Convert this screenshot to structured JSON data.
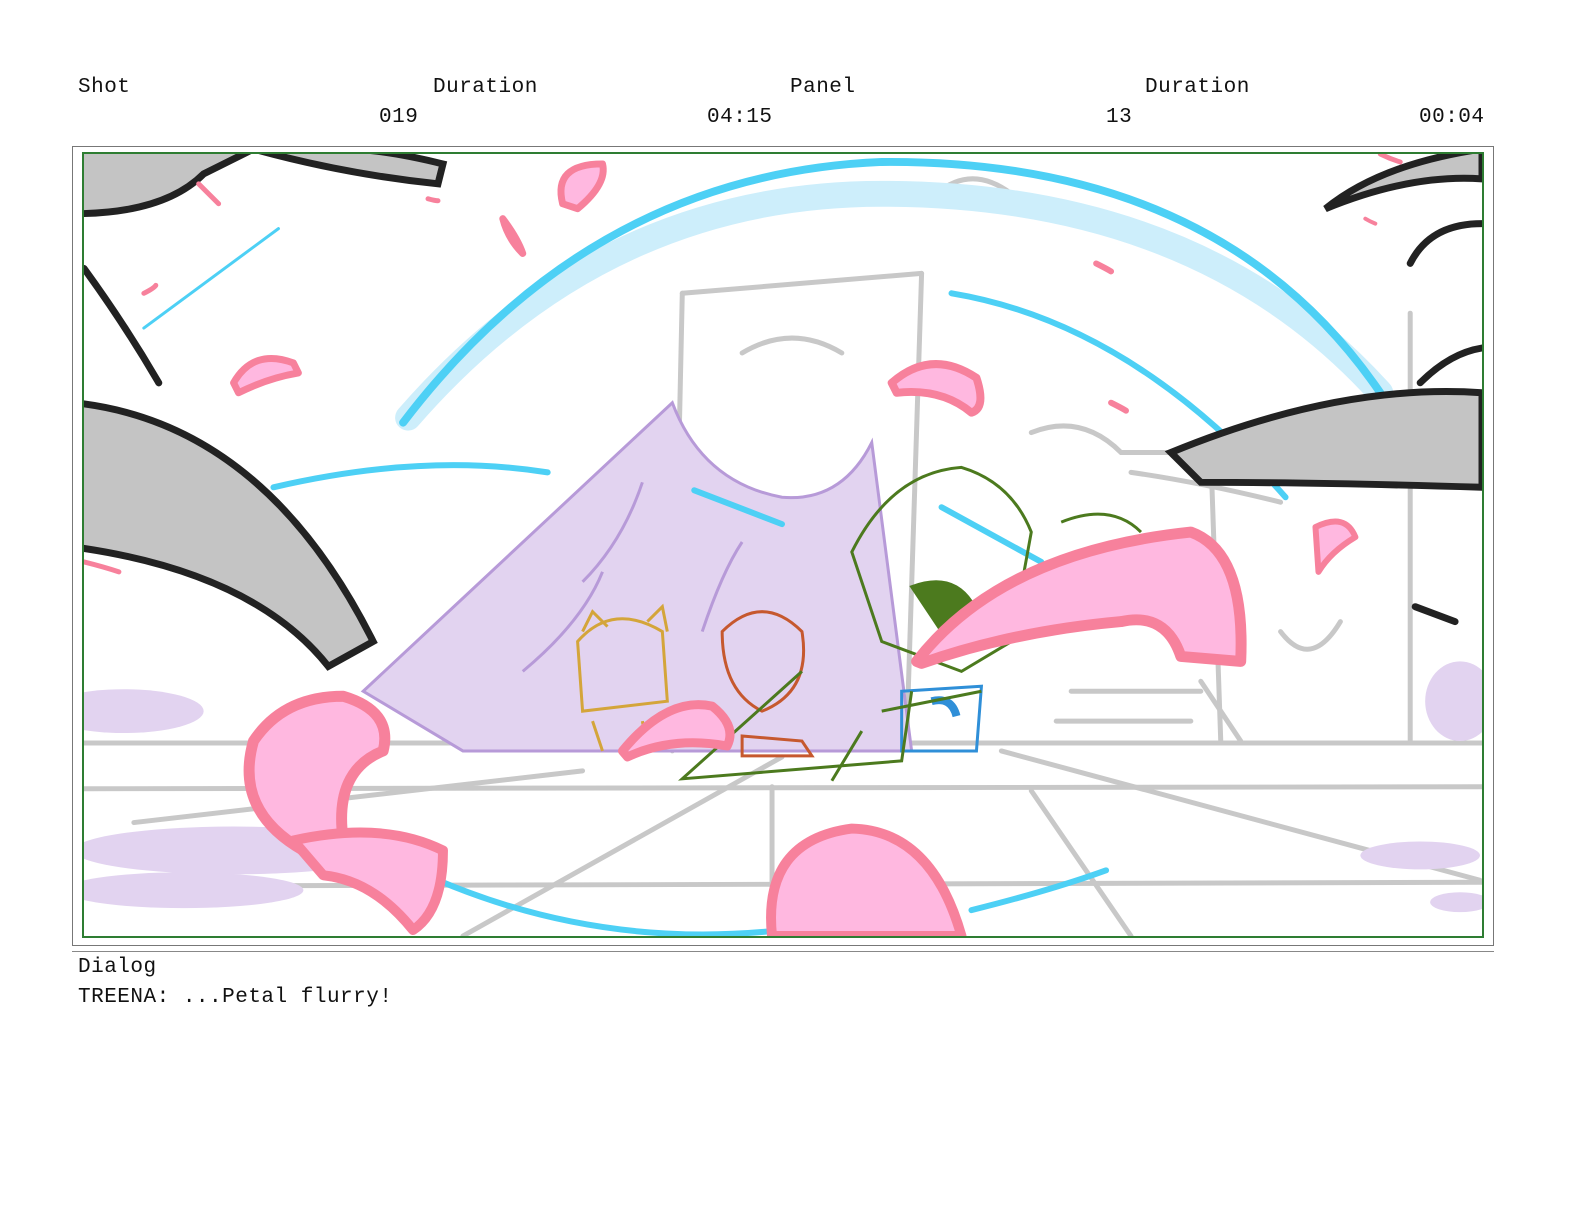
{
  "header": {
    "shot_label": "Shot",
    "shot_value": "019",
    "shot_duration_label": "Duration",
    "shot_duration_value": "04:15",
    "panel_label": "Panel",
    "panel_value": "13",
    "panel_duration_label": "Duration",
    "panel_duration_value": "00:04"
  },
  "panel": {
    "border_color": "#2e7d32",
    "palette": {
      "petal": "#f7819c",
      "petal_fill": "#ffb8e0",
      "magic": "#4dd0f5",
      "pyramid": "#e2d3f0",
      "sketch": "#c8c8c8",
      "thorn": "#c4c4c4"
    }
  },
  "dialog": {
    "label": "Dialog",
    "text": "TREENA: ...Petal flurry!"
  }
}
